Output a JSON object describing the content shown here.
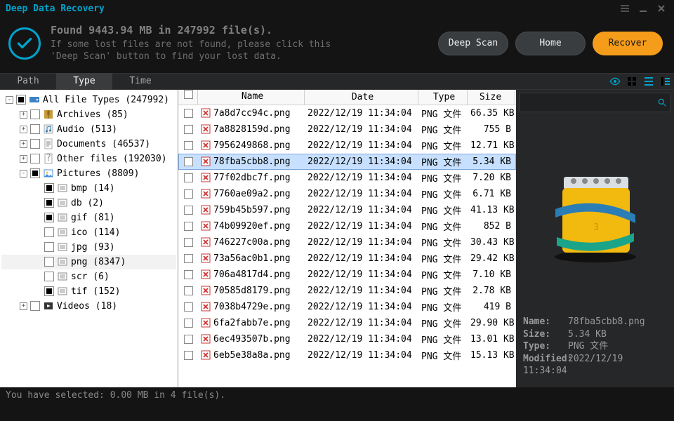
{
  "app_title": "Deep Data Recovery",
  "header": {
    "title": "Found 9443.94 MB in 247992 file(s).",
    "line1": "If some lost files are not found, please click this",
    "line2": "'Deep Scan' button to find your lost data.",
    "btn_deepscan": "Deep Scan",
    "btn_home": "Home",
    "btn_recover": "Recover"
  },
  "tabs": {
    "path": "Path",
    "type": "Type",
    "time": "Time"
  },
  "tree": [
    {
      "level": 0,
      "exp": "-",
      "chk": "part",
      "icon": "drive",
      "label": "All File Types (247992)"
    },
    {
      "level": 1,
      "exp": "+",
      "chk": "off",
      "icon": "archive",
      "label": "Archives (85)"
    },
    {
      "level": 1,
      "exp": "+",
      "chk": "off",
      "icon": "audio",
      "label": "Audio (513)"
    },
    {
      "level": 1,
      "exp": "+",
      "chk": "off",
      "icon": "doc",
      "label": "Documents (46537)"
    },
    {
      "level": 1,
      "exp": "+",
      "chk": "off",
      "icon": "other",
      "label": "Other files (192030)"
    },
    {
      "level": 1,
      "exp": "-",
      "chk": "part",
      "icon": "pic",
      "label": "Pictures (8809)"
    },
    {
      "level": 2,
      "exp": "",
      "chk": "full",
      "icon": "ext",
      "label": "bmp (14)"
    },
    {
      "level": 2,
      "exp": "",
      "chk": "full",
      "icon": "ext",
      "label": "db (2)"
    },
    {
      "level": 2,
      "exp": "",
      "chk": "full",
      "icon": "ext",
      "label": "gif (81)"
    },
    {
      "level": 2,
      "exp": "",
      "chk": "off",
      "icon": "ext",
      "label": "ico (114)"
    },
    {
      "level": 2,
      "exp": "",
      "chk": "off",
      "icon": "ext",
      "label": "jpg (93)"
    },
    {
      "level": 2,
      "exp": "",
      "chk": "off",
      "icon": "ext",
      "label": "png (8347)",
      "sel": true
    },
    {
      "level": 2,
      "exp": "",
      "chk": "off",
      "icon": "ext",
      "label": "scr (6)"
    },
    {
      "level": 2,
      "exp": "",
      "chk": "full",
      "icon": "ext",
      "label": "tif (152)"
    },
    {
      "level": 1,
      "exp": "+",
      "chk": "off",
      "icon": "video",
      "label": "Videos (18)"
    }
  ],
  "columns": {
    "name": "Name",
    "date": "Date",
    "type": "Type",
    "size": "Size"
  },
  "files": [
    {
      "sel": false,
      "name": "7a8d7cc94c.png",
      "date": "2022/12/19 11:34:04",
      "type": "PNG 文件",
      "size": "66.35 KB"
    },
    {
      "sel": false,
      "name": "7a8828159d.png",
      "date": "2022/12/19 11:34:04",
      "type": "PNG 文件",
      "size": "755 B"
    },
    {
      "sel": false,
      "name": "7956249868.png",
      "date": "2022/12/19 11:34:04",
      "type": "PNG 文件",
      "size": "12.71 KB"
    },
    {
      "sel": true,
      "name": "78fba5cbb8.png",
      "date": "2022/12/19 11:34:04",
      "type": "PNG 文件",
      "size": "5.34 KB"
    },
    {
      "sel": false,
      "name": "77f02dbc7f.png",
      "date": "2022/12/19 11:34:04",
      "type": "PNG 文件",
      "size": "7.20 KB"
    },
    {
      "sel": false,
      "name": "7760ae09a2.png",
      "date": "2022/12/19 11:34:04",
      "type": "PNG 文件",
      "size": "6.71 KB"
    },
    {
      "sel": false,
      "name": "759b45b597.png",
      "date": "2022/12/19 11:34:04",
      "type": "PNG 文件",
      "size": "41.13 KB"
    },
    {
      "sel": false,
      "name": "74b09920ef.png",
      "date": "2022/12/19 11:34:04",
      "type": "PNG 文件",
      "size": "852 B"
    },
    {
      "sel": false,
      "name": "746227c00a.png",
      "date": "2022/12/19 11:34:04",
      "type": "PNG 文件",
      "size": "30.43 KB"
    },
    {
      "sel": false,
      "name": "73a56ac0b1.png",
      "date": "2022/12/19 11:34:04",
      "type": "PNG 文件",
      "size": "29.42 KB"
    },
    {
      "sel": false,
      "name": "706a4817d4.png",
      "date": "2022/12/19 11:34:04",
      "type": "PNG 文件",
      "size": "7.10 KB"
    },
    {
      "sel": false,
      "name": "70585d8179.png",
      "date": "2022/12/19 11:34:04",
      "type": "PNG 文件",
      "size": "2.78 KB"
    },
    {
      "sel": false,
      "name": "7038b4729e.png",
      "date": "2022/12/19 11:34:04",
      "type": "PNG 文件",
      "size": "419 B"
    },
    {
      "sel": false,
      "name": "6fa2fabb7e.png",
      "date": "2022/12/19 11:34:04",
      "type": "PNG 文件",
      "size": "29.90 KB"
    },
    {
      "sel": false,
      "name": "6ec493507b.png",
      "date": "2022/12/19 11:34:04",
      "type": "PNG 文件",
      "size": "13.01 KB"
    },
    {
      "sel": false,
      "name": "6eb5e38a8a.png",
      "date": "2022/12/19 11:34:04",
      "type": "PNG 文件",
      "size": "15.13 KB"
    }
  ],
  "preview": {
    "name_label": "Name:",
    "name": "78fba5cbb8.png",
    "size_label": "Size:",
    "size": "5.34 KB",
    "type_label": "Type:",
    "type": "PNG 文件",
    "mod_label": "Modified:",
    "mod": "2022/12/19 11:34:04"
  },
  "footer": "You have selected: 0.00 MB in 4 file(s)."
}
